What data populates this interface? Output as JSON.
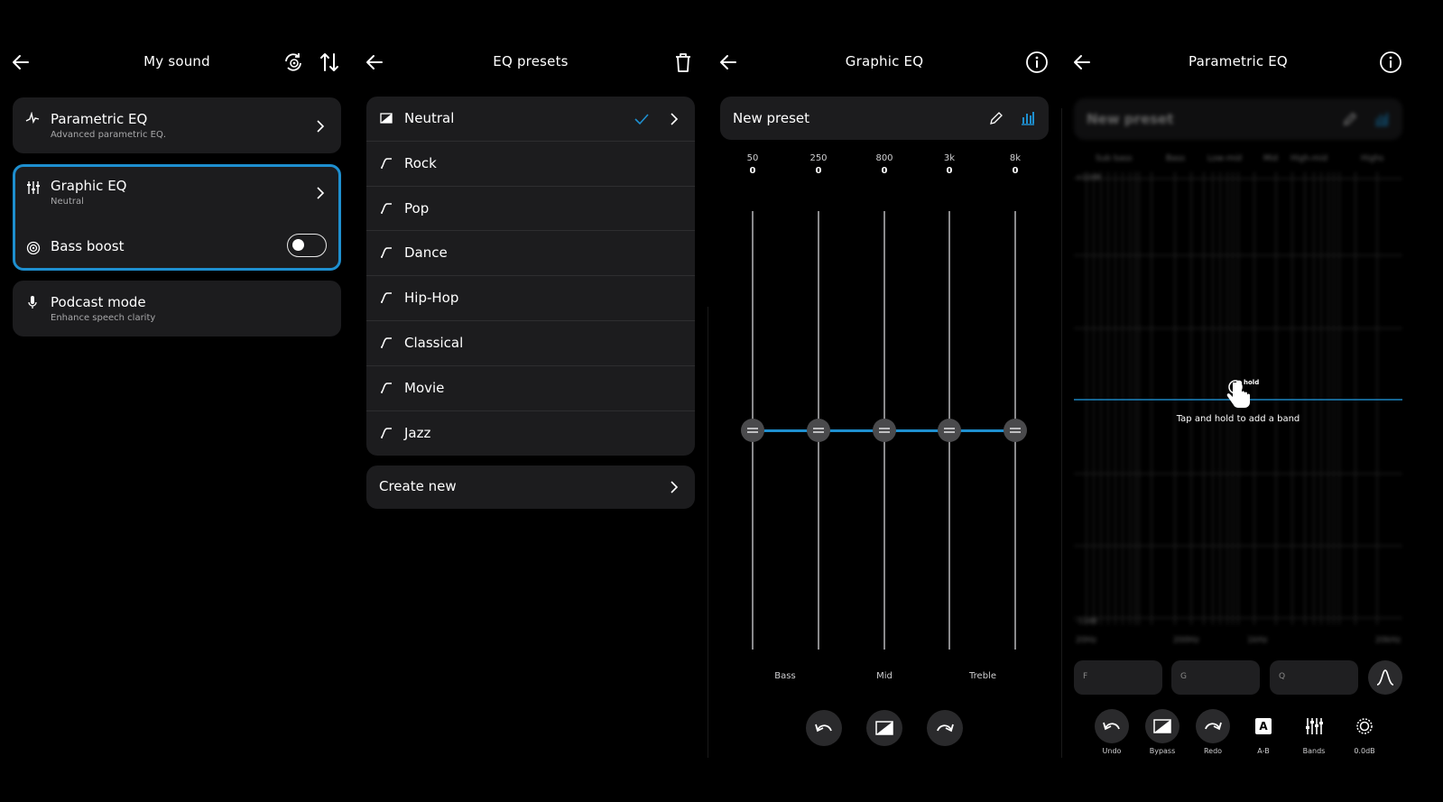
{
  "my_sound": {
    "title": "My sound",
    "items": [
      {
        "title": "Parametric EQ",
        "subtitle": "Advanced parametric EQ."
      },
      {
        "title": "Graphic EQ",
        "subtitle": "Neutral"
      },
      {
        "title": "Bass boost",
        "toggle_on": false
      },
      {
        "title": "Podcast mode",
        "subtitle": "Enhance speech clarity"
      }
    ]
  },
  "eq_presets": {
    "title": "EQ presets",
    "presets": [
      "Neutral",
      "Rock",
      "Pop",
      "Dance",
      "Hip-Hop",
      "Classical",
      "Movie",
      "Jazz"
    ],
    "selected": "Neutral",
    "create_new": "Create new"
  },
  "graphic_eq": {
    "title": "Graphic EQ",
    "preset_name": "New preset",
    "bands": [
      {
        "freq": "50",
        "gain": "0"
      },
      {
        "freq": "250",
        "gain": "0"
      },
      {
        "freq": "800",
        "gain": "0"
      },
      {
        "freq": "3k",
        "gain": "0"
      },
      {
        "freq": "8k",
        "gain": "0"
      }
    ],
    "regions": [
      "Bass",
      "Mid",
      "Treble"
    ]
  },
  "parametric_eq": {
    "title": "Parametric EQ",
    "preset_name": "New preset",
    "regions": [
      "Sub bass",
      "Bass",
      "Low-mid",
      "Mid",
      "High-mid",
      "Highs"
    ],
    "y_top": "+12dB",
    "y_bottom": "-12dB",
    "x_labels": [
      "20Hz",
      "200Hz",
      "1kHz",
      "20kHz"
    ],
    "hold_badge": "hold",
    "hint": "Tap and hold to add a band",
    "fields": [
      "F",
      "G",
      "Q"
    ],
    "tools": [
      "Undo",
      "Bypass",
      "Redo",
      "A-B",
      "Bands",
      "0.0dB"
    ],
    "ab_letter": "A"
  },
  "colors": {
    "accent": "#1e8fcf",
    "card": "#1c1c1e",
    "background": "#000000"
  }
}
